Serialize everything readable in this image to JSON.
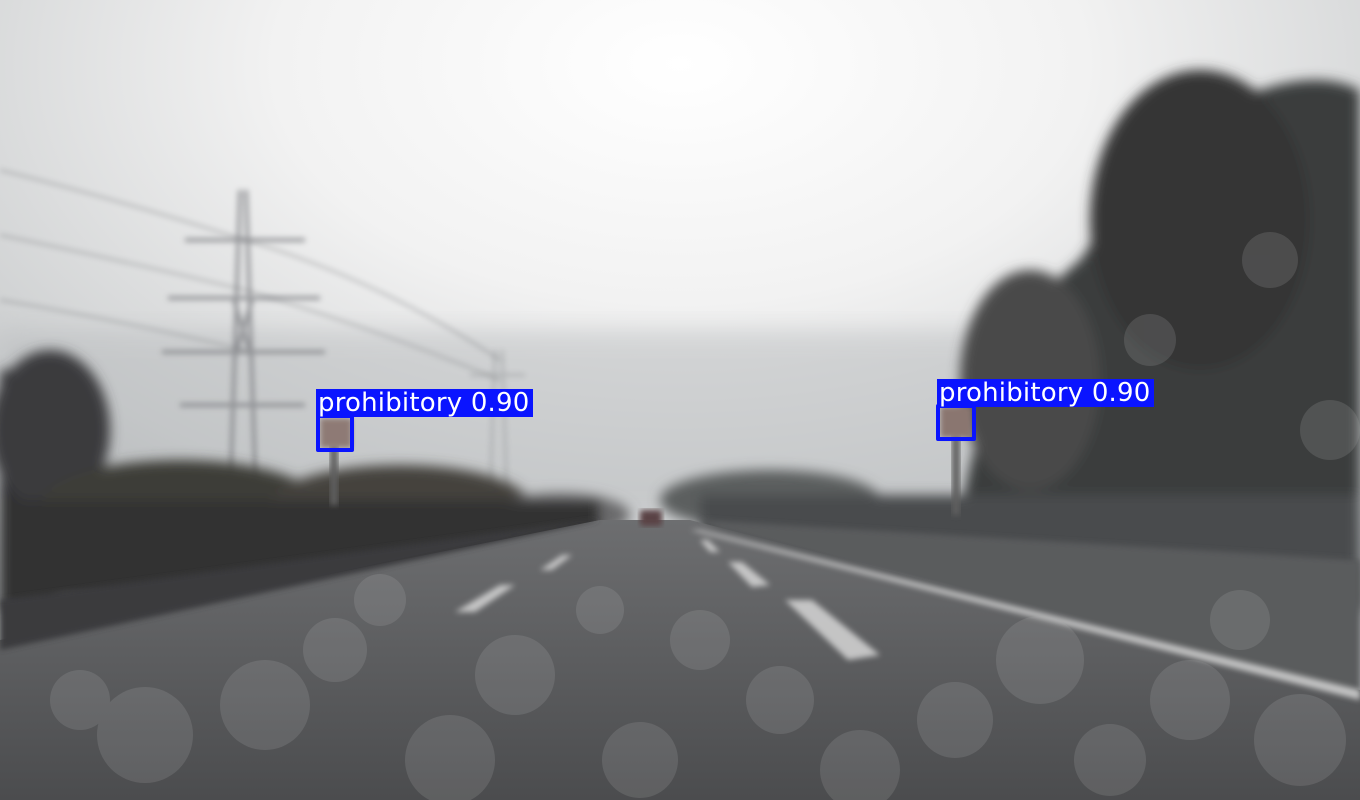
{
  "detections": [
    {
      "class_label": "prohibitory",
      "confidence": "0.90"
    },
    {
      "class_label": "prohibitory",
      "confidence": "0.90"
    }
  ],
  "colors": {
    "box": "#0a14ff",
    "label_text": "#ffffff"
  }
}
